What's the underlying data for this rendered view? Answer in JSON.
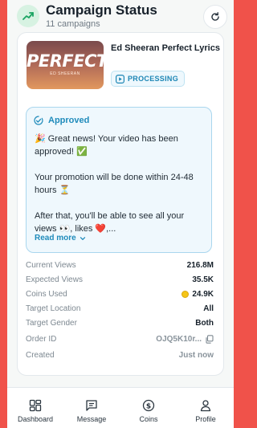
{
  "header": {
    "title": "Campaign Status",
    "subtitle": "11 campaigns",
    "icon": "trending-up-icon",
    "refresh_icon": "refresh-icon"
  },
  "campaign": {
    "thumbnail": {
      "title": "PERFECT",
      "artist": "ED SHEERAN"
    },
    "video_title": "Ed Sheeran  Perfect Lyrics",
    "status": "PROCESSING",
    "approved": {
      "label": "Approved",
      "lines": [
        "🎉 Great news! Your video has been approved! ✅",
        "Your promotion will be done within 24-48 hours ⏳",
        "After that, you'll be able to see all your views 👀, likes ❤️,..."
      ],
      "read_more": "Read more"
    },
    "stats": {
      "current_views": {
        "label": "Current Views",
        "value": "216.8M"
      },
      "expected_views": {
        "label": "Expected Views",
        "value": "35.5K"
      },
      "coins_used": {
        "label": "Coins Used",
        "value": "24.9K"
      },
      "target_location": {
        "label": "Target Location",
        "value": "All"
      },
      "target_gender": {
        "label": "Target Gender",
        "value": "Both"
      },
      "order_id": {
        "label": "Order ID",
        "value": "OJQ5K10r..."
      },
      "created": {
        "label": "Created",
        "value": "Just now"
      }
    }
  },
  "nav": [
    {
      "label": "Dashboard",
      "icon": "dashboard-icon"
    },
    {
      "label": "Message",
      "icon": "message-icon"
    },
    {
      "label": "Coins",
      "icon": "coins-icon"
    },
    {
      "label": "Profile",
      "icon": "profile-icon"
    }
  ],
  "colors": {
    "frame": "#f0524a",
    "accent": "#1f8bbb",
    "header_icon_bg": "#d7f2e2",
    "header_icon": "#1aa462",
    "approved_bg": "#eff8fd"
  }
}
